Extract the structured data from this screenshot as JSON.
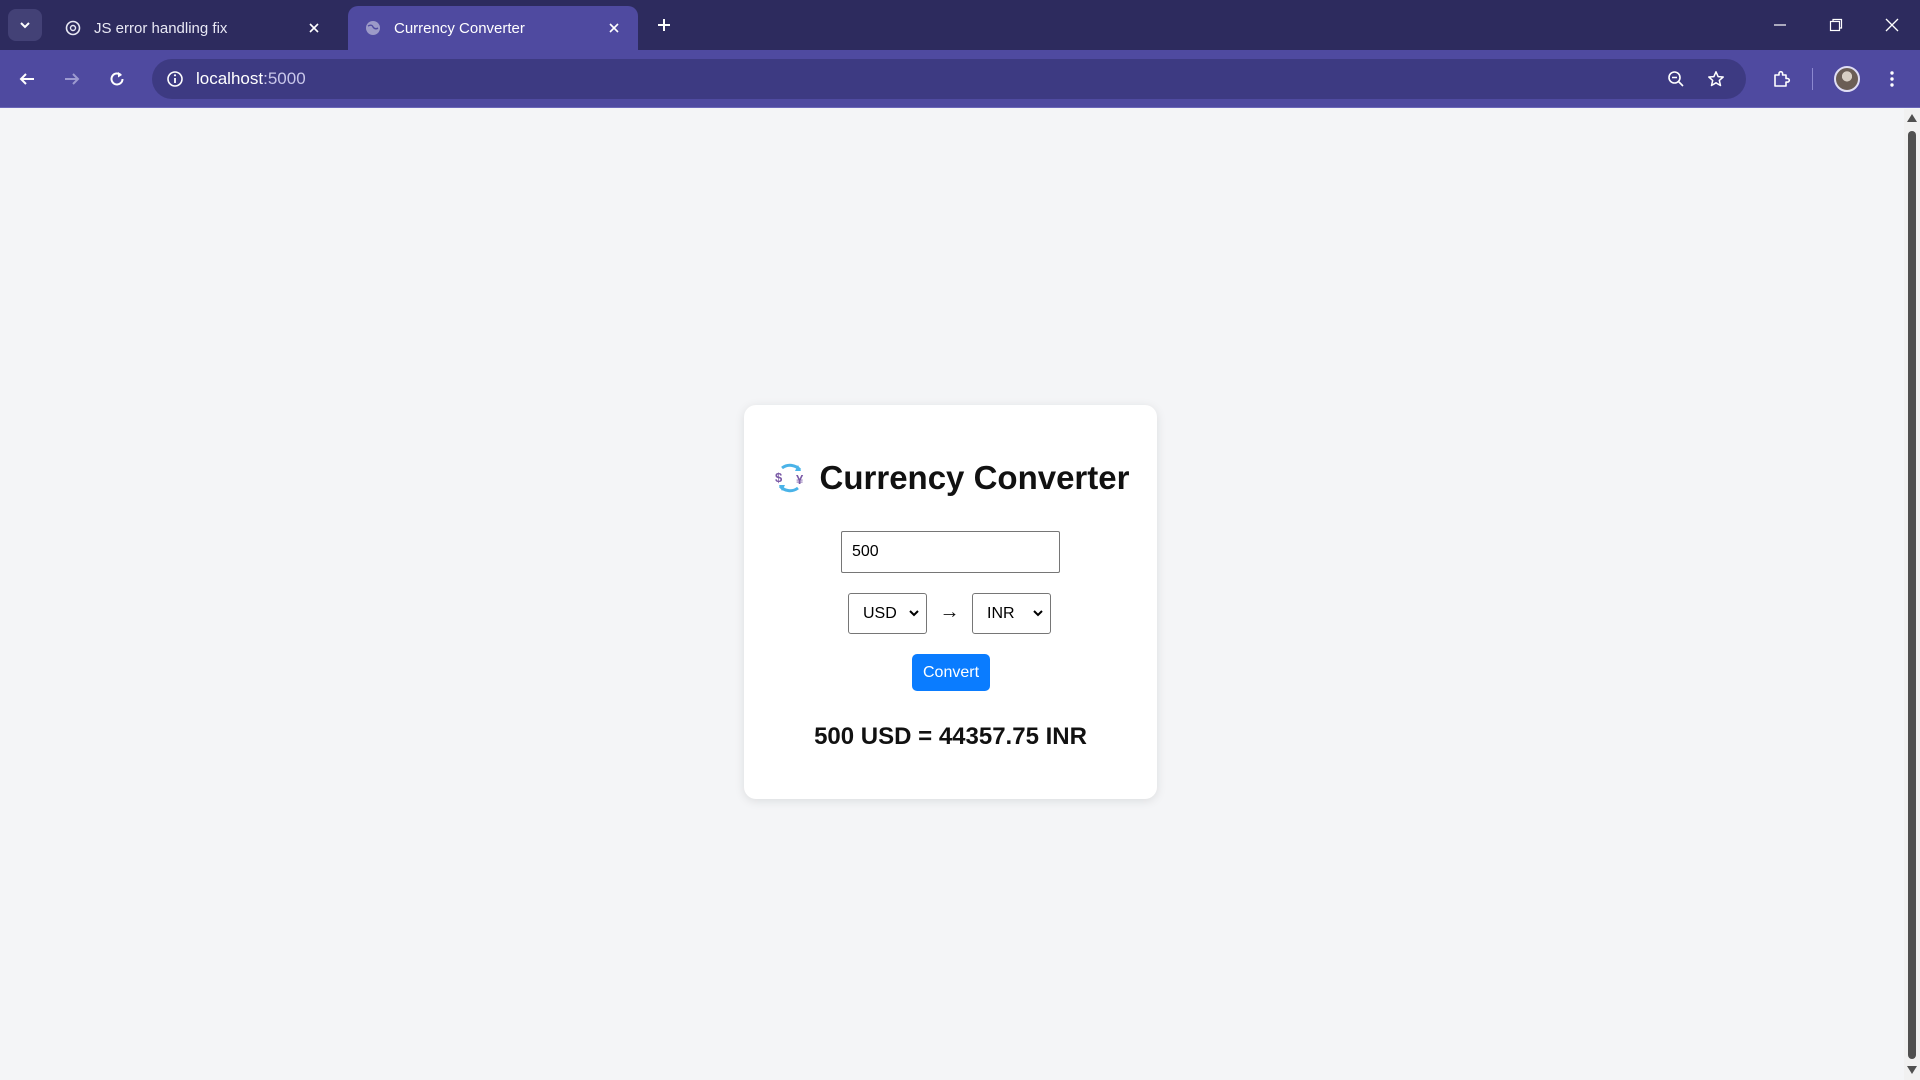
{
  "browser": {
    "tabs": [
      {
        "title": "JS error handling fix",
        "active": false
      },
      {
        "title": "Currency Converter",
        "active": true
      }
    ],
    "url_host": "localhost",
    "url_port": ":5000"
  },
  "card": {
    "title": "Currency Converter",
    "title_icon": "currency-exchange-icon",
    "amount_value": "500",
    "from_currency": "USD",
    "arrow": "→",
    "to_currency": "INR",
    "convert_label": "Convert",
    "result_text": "500 USD = 44357.75 INR"
  },
  "colors": {
    "tabstrip": "#2d2b5e",
    "toolbar": "#4f4aa0",
    "page_bg": "#f4f5f7",
    "button": "#0a7cff"
  }
}
